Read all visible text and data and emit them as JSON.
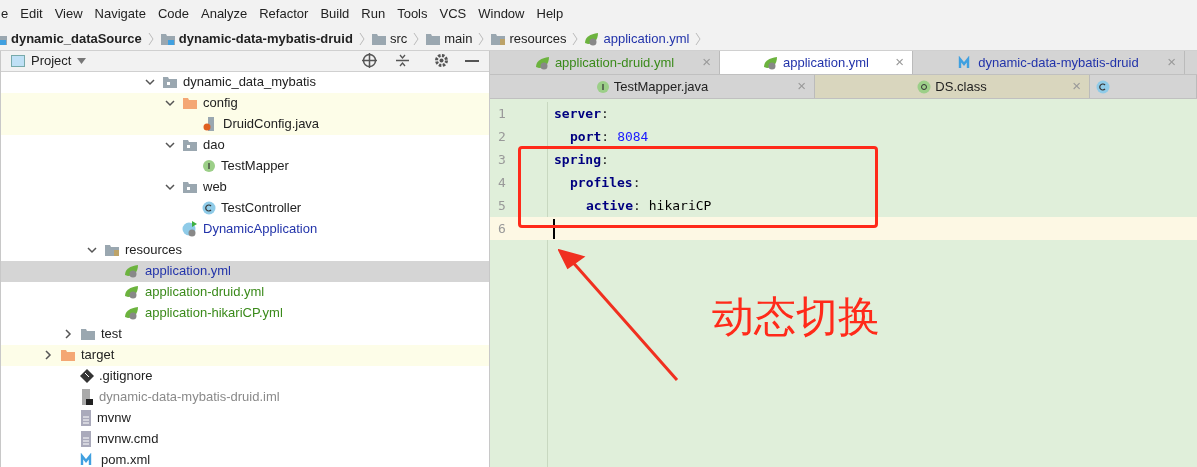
{
  "menu": [
    "e",
    "Edit",
    "View",
    "Navigate",
    "Code",
    "Analyze",
    "Refactor",
    "Build",
    "Run",
    "Tools",
    "VCS",
    "Window",
    "Help"
  ],
  "breadcrumb": [
    {
      "label": "dynamic_dataSource",
      "kind": "module",
      "bold": true
    },
    {
      "label": "dynamic-data-mybatis-druid",
      "kind": "module",
      "bold": true
    },
    {
      "label": "src",
      "kind": "folder",
      "bold": false
    },
    {
      "label": "main",
      "kind": "folder",
      "bold": false
    },
    {
      "label": "resources",
      "kind": "resources",
      "bold": false
    },
    {
      "label": "application.yml",
      "kind": "yml",
      "bold": false
    }
  ],
  "project_panel": {
    "title": "Project",
    "tree": [
      {
        "label": "dynamic_data_mybatis",
        "kind": "package",
        "color": "#222222",
        "expanded": true,
        "highlighted": false,
        "selected": false,
        "children": [
          {
            "label": "config",
            "kind": "excluded-folder",
            "color": "#222222",
            "expanded": true,
            "highlighted": true,
            "selected": false,
            "children": [
              {
                "label": "DruidConfig.java",
                "kind": "java",
                "color": "#222222",
                "highlighted": true,
                "selected": false
              }
            ]
          },
          {
            "label": "dao",
            "kind": "package",
            "color": "#222222",
            "expanded": true,
            "highlighted": false,
            "selected": false,
            "children": [
              {
                "label": "TestMapper",
                "kind": "interface",
                "color": "#222222",
                "highlighted": false,
                "selected": false
              }
            ]
          },
          {
            "label": "web",
            "kind": "package",
            "color": "#222222",
            "expanded": true,
            "highlighted": false,
            "selected": false,
            "children": [
              {
                "label": "TestController",
                "kind": "class",
                "color": "#222222",
                "highlighted": false,
                "selected": false
              }
            ]
          },
          {
            "label": "DynamicApplication",
            "kind": "spring-app",
            "color": "#2233aa",
            "highlighted": false,
            "selected": false
          }
        ]
      },
      {
        "label": "resources",
        "kind": "resources",
        "color": "#222222",
        "expanded": true,
        "highlighted": false,
        "selected": false,
        "children": [
          {
            "label": "application.yml",
            "kind": "yml",
            "color": "#2233aa",
            "selected": true
          },
          {
            "label": "application-druid.yml",
            "kind": "yml",
            "color": "#3a8a1a",
            "highlighted": false,
            "selected": false
          },
          {
            "label": "application-hikariCP.yml",
            "kind": "yml",
            "color": "#3a8a1a",
            "highlighted": false,
            "selected": false
          }
        ]
      },
      {
        "label": "test",
        "kind": "folder",
        "color": "#222222",
        "expanded": false,
        "highlighted": false,
        "selected": false
      },
      {
        "label": "target",
        "kind": "excluded-folder",
        "color": "#222222",
        "expanded": false,
        "highlighted": true,
        "selected": false
      },
      {
        "label": ".gitignore",
        "kind": "git",
        "color": "#222222",
        "highlighted": false,
        "selected": false
      },
      {
        "label": "dynamic-data-mybatis-druid.iml",
        "kind": "iml",
        "color": "#8a8a8a",
        "highlighted": false,
        "selected": false
      },
      {
        "label": "mvnw",
        "kind": "text",
        "color": "#222222",
        "highlighted": false,
        "selected": false
      },
      {
        "label": "mvnw.cmd",
        "kind": "text",
        "color": "#222222",
        "highlighted": false,
        "selected": false
      },
      {
        "label": "pom.xml",
        "kind": "maven",
        "color": "#222222",
        "highlighted": false,
        "selected": false
      }
    ]
  },
  "editor_tabs": [
    [
      {
        "label": "application-druid.yml",
        "kind": "yml",
        "color": "#3a8a1a",
        "selected": false,
        "close": "×"
      },
      {
        "label": "application.yml",
        "kind": "yml",
        "color": "#2233aa",
        "selected": true,
        "close": "×"
      },
      {
        "label": "dynamic-data-mybatis-druid",
        "kind": "maven",
        "color": "#2233aa",
        "selected": false,
        "close": "×"
      }
    ],
    [
      {
        "label": "TestMapper.java",
        "kind": "interface",
        "color": "#222222",
        "selected": false,
        "close": "×"
      },
      {
        "label": "DS.class",
        "kind": "annotation",
        "color": "#222222",
        "selected": false,
        "close": "×"
      },
      {
        "kind": "class",
        "selected": false
      }
    ]
  ],
  "editor": {
    "line_numbers": [
      "1",
      "2",
      "3",
      "4",
      "5",
      "6"
    ],
    "yaml": [
      {
        "key": "server",
        "colon": ":",
        "children": [
          {
            "key": "port",
            "colon": ":",
            "value": "8084",
            "kind": "number"
          }
        ]
      },
      {
        "key": "spring",
        "colon": ":",
        "children": [
          {
            "key": "profiles",
            "colon": ":",
            "children": [
              {
                "key": "active",
                "colon": ":",
                "value": "hikariCP",
                "kind": "string"
              }
            ]
          }
        ]
      }
    ]
  },
  "annotation": {
    "text": "动态切换"
  }
}
